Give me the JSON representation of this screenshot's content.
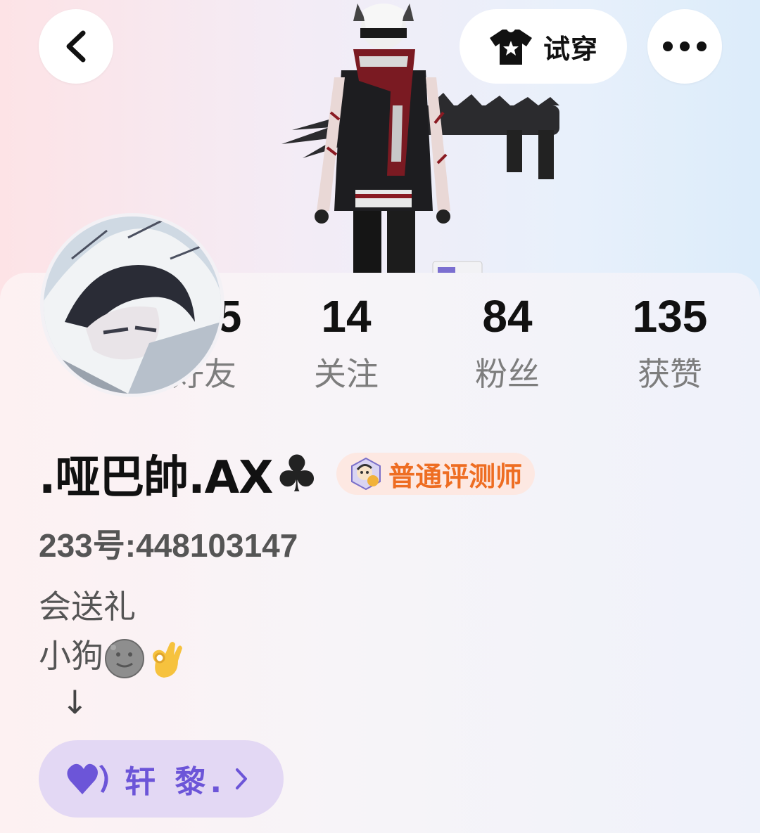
{
  "header": {
    "back_icon": "chevron-left-icon",
    "try_on": {
      "icon": "shirt-icon",
      "label": "试穿"
    },
    "more_icon": "more-dots-icon"
  },
  "profile": {
    "stats": [
      {
        "value": "145",
        "label": "好友"
      },
      {
        "value": "14",
        "label": "关注"
      },
      {
        "value": "84",
        "label": "粉丝"
      },
      {
        "value": "135",
        "label": "获赞"
      }
    ],
    "username": ".哑巴帥.AX",
    "username_suffix": "♣",
    "badge": {
      "label": "普通评测师",
      "color": "#ee6d22"
    },
    "uid": "233号:448103147",
    "bio": {
      "line1": "会送礼",
      "line2": "小狗",
      "arrow": "↓"
    }
  },
  "cp_pill": {
    "icon": "heart-icon",
    "label": "轩 黎.",
    "color": "#6c55d8"
  }
}
